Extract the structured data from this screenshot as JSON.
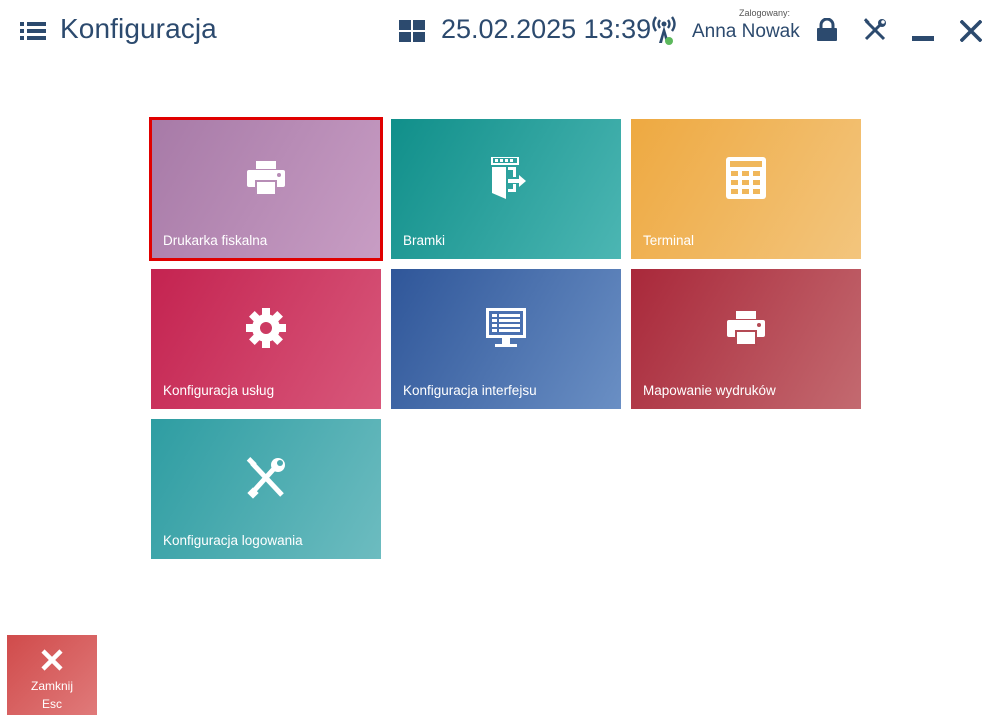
{
  "header": {
    "title": "Konfiguracja",
    "datetime": "25.02.2025 13:39",
    "logged_label": "Zalogowany:",
    "user_name": "Anna Nowak",
    "icons": [
      "list-menu-icon",
      "tiles-icon",
      "antenna-icon",
      "lock-icon",
      "tools-icon",
      "minimize-icon",
      "close-icon"
    ]
  },
  "tiles": [
    {
      "label": "Drukarka fiskalna",
      "icon": "printer-icon",
      "selected": true
    },
    {
      "label": "Bramki",
      "icon": "gate-icon",
      "selected": false
    },
    {
      "label": "Terminal",
      "icon": "calculator-icon",
      "selected": false
    },
    {
      "label": "Konfiguracja usług",
      "icon": "gear-icon",
      "selected": false
    },
    {
      "label": "Konfiguracja interfejsu",
      "icon": "monitor-icon",
      "selected": false
    },
    {
      "label": "Mapowanie wydruków",
      "icon": "printer-icon",
      "selected": false
    },
    {
      "label": "Konfiguracja logowania",
      "icon": "tools-icon",
      "selected": false
    }
  ],
  "close_button": {
    "label": "Zamknij",
    "shortcut": "Esc"
  },
  "colors": {
    "text": "#2c4a6e",
    "selection": "#e00000",
    "antenna_status": "#5cb85c"
  }
}
